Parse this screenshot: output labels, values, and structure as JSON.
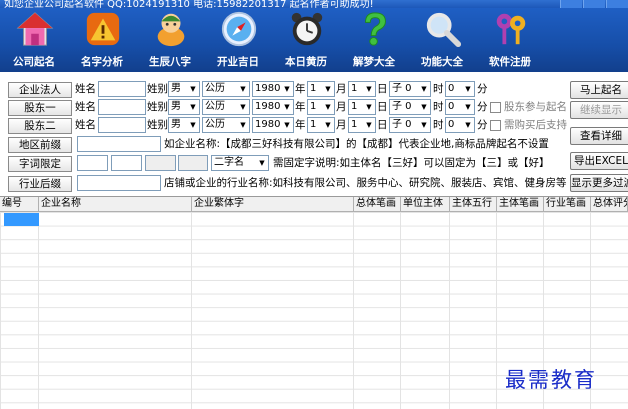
{
  "titlebar": {
    "text": "如您企业公司起名软件 QQ:1024191310 电话:15982201317 起名作者可助成功!"
  },
  "toolbar": [
    {
      "label": "公司起名",
      "icon": "house-icon"
    },
    {
      "label": "名字分析",
      "icon": "warning-sign-icon"
    },
    {
      "label": "生辰八字",
      "icon": "baby-icon"
    },
    {
      "label": "开业吉日",
      "icon": "compass-icon"
    },
    {
      "label": "本日黄历",
      "icon": "alarm-clock-icon"
    },
    {
      "label": "解梦大全",
      "icon": "question-mark-icon"
    },
    {
      "label": "功能大全",
      "icon": "magnifier-icon"
    },
    {
      "label": "软件注册",
      "icon": "keys-icon"
    }
  ],
  "form": {
    "row1": {
      "label": "企业法人",
      "name": "姓名",
      "gender": "姓别",
      "gender_val": "男",
      "calendar": "公历",
      "year": "1980",
      "year_u": "年",
      "month": "1",
      "month_u": "月",
      "day": "1",
      "day_u": "日",
      "hour": "子 0",
      "hour_u": "时",
      "minute": "0",
      "minute_u": "分"
    },
    "row2": {
      "label": "股东一",
      "name": "姓名",
      "gender": "姓别",
      "gender_val": "男",
      "calendar": "公历",
      "year": "1980",
      "year_u": "年",
      "month": "1",
      "month_u": "月",
      "day": "1",
      "day_u": "日",
      "hour": "子 0",
      "hour_u": "时",
      "minute": "0",
      "minute_u": "分",
      "check": "股东参与起名"
    },
    "row3": {
      "label": "股东二",
      "name": "姓名",
      "gender": "姓别",
      "gender_val": "男",
      "calendar": "公历",
      "year": "1980",
      "year_u": "年",
      "month": "1",
      "month_u": "月",
      "day": "1",
      "day_u": "日",
      "hour": "子 0",
      "hour_u": "时",
      "minute": "0",
      "minute_u": "分",
      "check": "需购买后支持"
    },
    "row4": {
      "label": "地区前缀",
      "note": "如企业名称:【成都三好科技有限公司】的【成都】代表企业地,商标品牌起名不设置"
    },
    "row5": {
      "label": "字词限定",
      "select": "二字名",
      "note": "需固定字说明:如主体名【三好】可以固定为【三】或【好】"
    },
    "row6": {
      "label": "行业后缀",
      "note": "店铺或企业的行业名称:如科技有限公司、服务中心、研究院、服装店、宾馆、健身房等"
    },
    "buttons": {
      "start": "马上起名",
      "continue": "继续显示",
      "detail": "查看详细",
      "export": "导出EXCEL",
      "more": "显示更多过滤"
    }
  },
  "table": {
    "columns": [
      "编号",
      "企业名称",
      "企业繁体字",
      "总体笔画",
      "单位主体",
      "主体五行",
      "主体笔画",
      "行业笔画",
      "总体评分"
    ]
  },
  "watermark": "最需教育"
}
